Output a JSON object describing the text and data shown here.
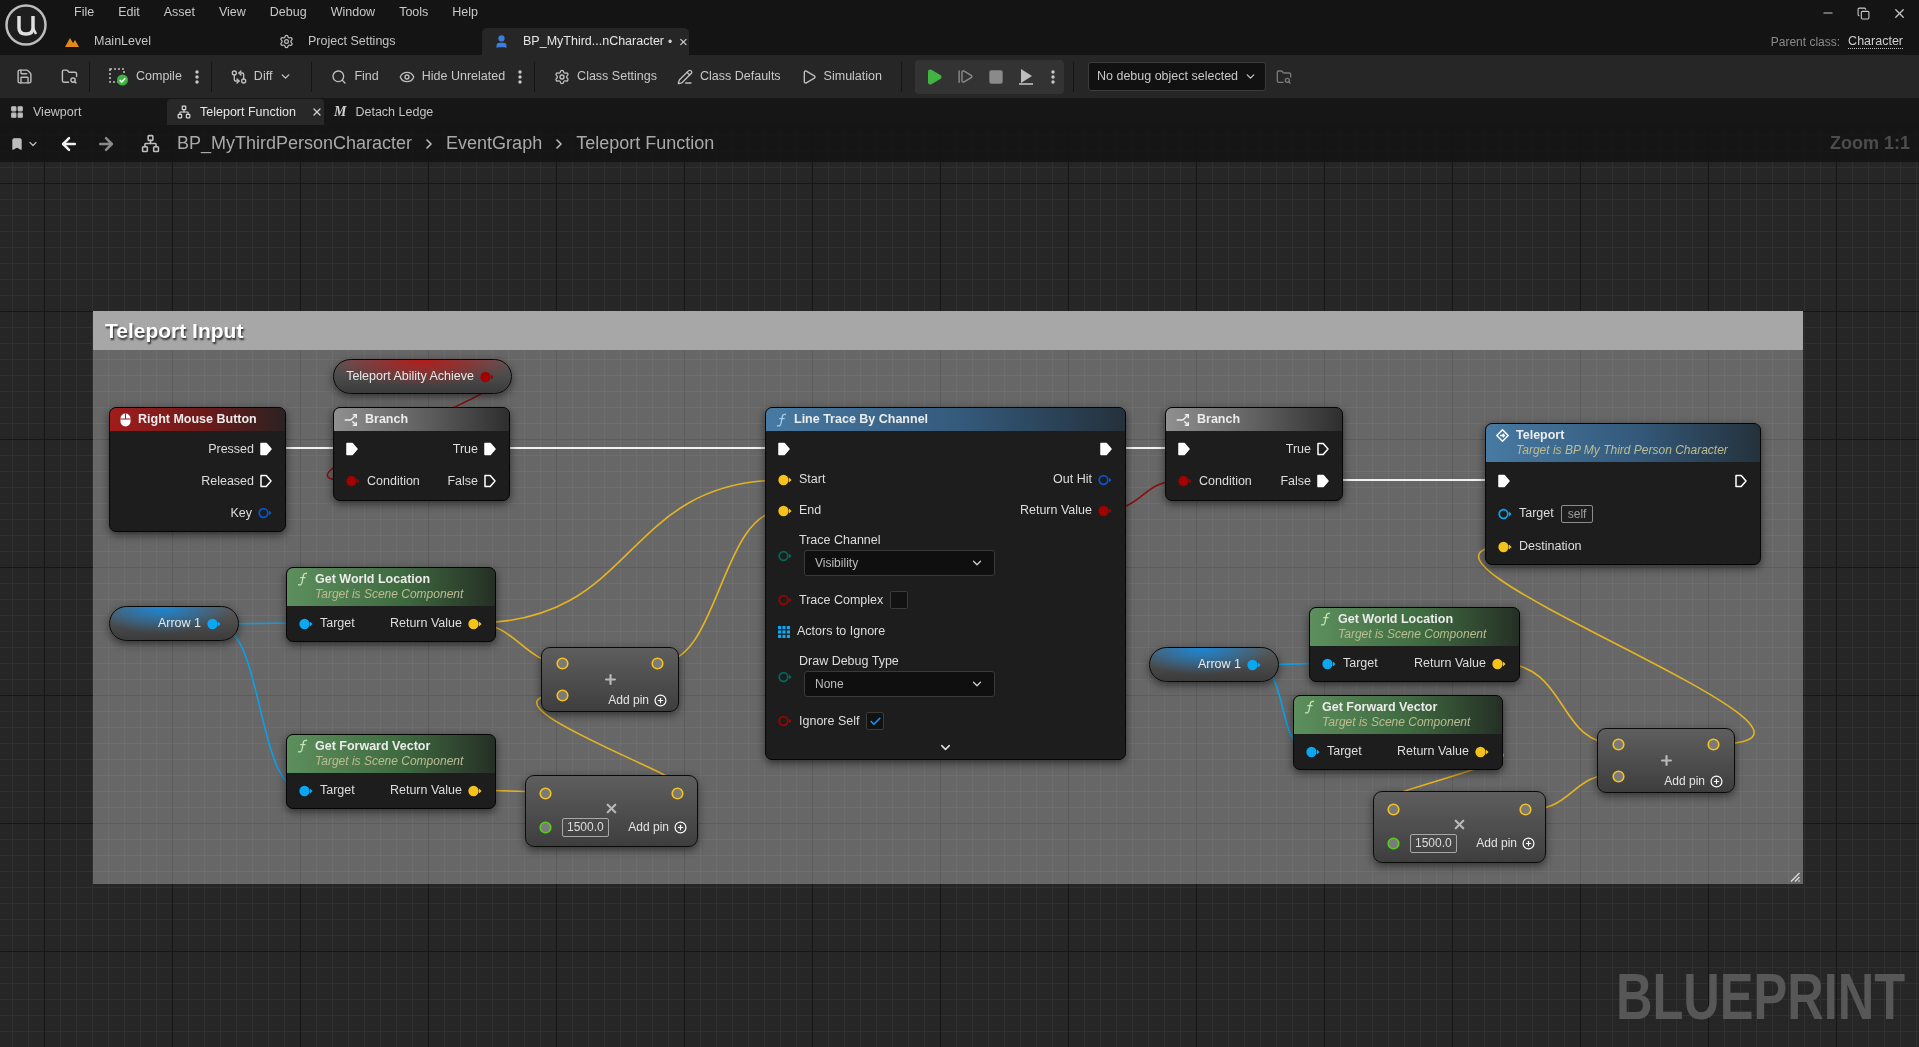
{
  "app_bar": {
    "menu": [
      "File",
      "Edit",
      "Asset",
      "View",
      "Debug",
      "Window",
      "Tools",
      "Help"
    ],
    "tabs": [
      {
        "kind": "level",
        "label": "MainLevel",
        "selected": false,
        "closable": false
      },
      {
        "kind": "settings",
        "label": "Project Settings",
        "selected": false,
        "closable": false
      },
      {
        "kind": "blueprint",
        "label": "BP_MyThird...nCharacter",
        "modified_mark": "•",
        "selected": true,
        "closable": true
      }
    ],
    "parent_class": {
      "label": "Parent class:",
      "value": "Character"
    }
  },
  "toolbar": {
    "buttons": [
      {
        "kind": "compile",
        "label": "Compile",
        "more": true,
        "dropdown": false
      },
      {
        "kind": "diff",
        "label": "Diff",
        "more": false,
        "dropdown": true
      },
      {
        "kind": "find",
        "label": "Find",
        "more": false,
        "dropdown": false
      },
      {
        "kind": "hide_unrelated",
        "label": "Hide Unrelated",
        "more": true,
        "dropdown": false
      },
      {
        "kind": "class_settings",
        "label": "Class Settings",
        "more": false,
        "dropdown": false
      },
      {
        "kind": "class_defaults",
        "label": "Class Defaults",
        "more": false,
        "dropdown": false
      },
      {
        "kind": "simulation",
        "label": "Simulation",
        "more": false,
        "dropdown": false
      }
    ],
    "debug_object": "No debug object selected"
  },
  "document_tabs": [
    {
      "kind": "viewport",
      "label": "Viewport",
      "selected": false,
      "closable": false
    },
    {
      "kind": "graph",
      "label": "Teleport Function",
      "selected": true,
      "closable": true
    },
    {
      "kind": "macro",
      "icon_glyph": "M",
      "label": "Detach Ledge",
      "selected": false,
      "closable": false
    }
  ],
  "breadcrumb": {
    "path": [
      "BP_MyThirdPersonCharacter",
      "EventGraph",
      "Teleport Function"
    ],
    "zoom": "Zoom 1:1"
  },
  "graph": {
    "comment": {
      "title": "Teleport Input"
    },
    "nodes": [
      {
        "kind": "variable",
        "title": "Teleport Ability Achieve",
        "output": {
          "kind": "bool",
          "connected": true
        }
      },
      {
        "kind": "event",
        "title": "Right Mouse Button",
        "outputs": [
          {
            "label": "Pressed",
            "kind": "exec",
            "connected": true
          },
          {
            "label": "Released",
            "kind": "exec",
            "connected": false
          },
          {
            "label": "Key",
            "kind": "struct",
            "connected": false
          }
        ]
      },
      {
        "kind": "branch",
        "title": "Branch",
        "inputs": [
          {
            "kind": "exec",
            "connected": true
          },
          {
            "label": "Condition",
            "kind": "bool",
            "connected": true
          }
        ],
        "outputs": [
          {
            "label": "True",
            "kind": "exec",
            "connected": true
          },
          {
            "label": "False",
            "kind": "exec",
            "connected": false
          }
        ]
      },
      {
        "kind": "function",
        "title": "Line Trace By Channel",
        "inputs": [
          {
            "kind": "exec",
            "connected": true
          },
          {
            "label": "Start",
            "kind": "vector",
            "connected": true
          },
          {
            "label": "End",
            "kind": "vector",
            "connected": true
          },
          {
            "label": "Trace Channel",
            "kind": "enum",
            "connected": false,
            "value": "Visibility"
          },
          {
            "label": "Trace Complex",
            "kind": "bool",
            "connected": false,
            "checked": false
          },
          {
            "label": "Actors to Ignore",
            "kind": "array"
          },
          {
            "label": "Draw Debug Type",
            "kind": "enum",
            "connected": false,
            "value": "None"
          },
          {
            "label": "Ignore Self",
            "kind": "bool",
            "connected": false,
            "checked": true
          }
        ],
        "outputs": [
          {
            "kind": "exec",
            "connected": true
          },
          {
            "label": "Out Hit",
            "kind": "struct",
            "connected": false
          },
          {
            "label": "Return Value",
            "kind": "bool",
            "connected": true
          }
        ],
        "advanced_expanded": false
      },
      {
        "kind": "branch",
        "title": "Branch",
        "inputs": [
          {
            "kind": "exec",
            "connected": true
          },
          {
            "label": "Condition",
            "kind": "bool",
            "connected": true
          }
        ],
        "outputs": [
          {
            "label": "True",
            "kind": "exec",
            "connected": false
          },
          {
            "label": "False",
            "kind": "exec",
            "connected": true
          }
        ]
      },
      {
        "kind": "custom_function",
        "title": "Teleport",
        "subtitle": "Target is BP My Third Person Character",
        "inputs": [
          {
            "kind": "exec",
            "connected": true
          },
          {
            "label": "Target",
            "kind": "object",
            "connected": false,
            "value": "self"
          },
          {
            "label": "Destination",
            "kind": "vector",
            "connected": true
          }
        ],
        "outputs": [
          {
            "kind": "exec",
            "connected": false
          }
        ]
      },
      {
        "kind": "variable",
        "title": "Arrow 1",
        "output": {
          "kind": "object",
          "connected": true
        }
      },
      {
        "kind": "pure_function",
        "title": "Get World Location",
        "subtitle": "Target is Scene Component",
        "inputs": [
          {
            "label": "Target",
            "kind": "object",
            "connected": true
          }
        ],
        "outputs": [
          {
            "label": "Return Value",
            "kind": "vector",
            "connected": true
          }
        ]
      },
      {
        "kind": "add",
        "inputs": [
          {
            "kind": "vector"
          },
          {
            "kind": "vector"
          }
        ],
        "output": {
          "kind": "vector"
        },
        "add_pin": "Add pin"
      },
      {
        "kind": "pure_function",
        "title": "Get Forward Vector",
        "subtitle": "Target is Scene Component",
        "inputs": [
          {
            "label": "Target",
            "kind": "object",
            "connected": true
          }
        ],
        "outputs": [
          {
            "label": "Return Value",
            "kind": "vector",
            "connected": true
          }
        ]
      },
      {
        "kind": "multiply",
        "inputs": [
          {
            "kind": "vector"
          },
          {
            "kind": "float",
            "value": "1500.0"
          }
        ],
        "output": {
          "kind": "vector"
        },
        "add_pin": "Add pin"
      },
      {
        "kind": "variable",
        "title": "Arrow 1",
        "output": {
          "kind": "object",
          "connected": true
        }
      },
      {
        "kind": "pure_function",
        "title": "Get World Location",
        "subtitle": "Target is Scene Component",
        "inputs": [
          {
            "label": "Target",
            "kind": "object",
            "connected": true
          }
        ],
        "outputs": [
          {
            "label": "Return Value",
            "kind": "vector",
            "connected": true
          }
        ]
      },
      {
        "kind": "pure_function",
        "title": "Get Forward Vector",
        "subtitle": "Target is Scene Component",
        "inputs": [
          {
            "label": "Target",
            "kind": "object",
            "connected": true
          }
        ],
        "outputs": [
          {
            "label": "Return Value",
            "kind": "vector",
            "connected": true
          }
        ]
      },
      {
        "kind": "add",
        "inputs": [
          {
            "kind": "vector"
          },
          {
            "kind": "vector"
          }
        ],
        "output": {
          "kind": "vector"
        },
        "add_pin": "Add pin"
      },
      {
        "kind": "multiply",
        "inputs": [
          {
            "kind": "vector"
          },
          {
            "kind": "float",
            "value": "1500.0"
          }
        ],
        "output": {
          "kind": "vector"
        },
        "add_pin": "Add pin"
      }
    ],
    "type_label": "BLUEPRINT"
  }
}
